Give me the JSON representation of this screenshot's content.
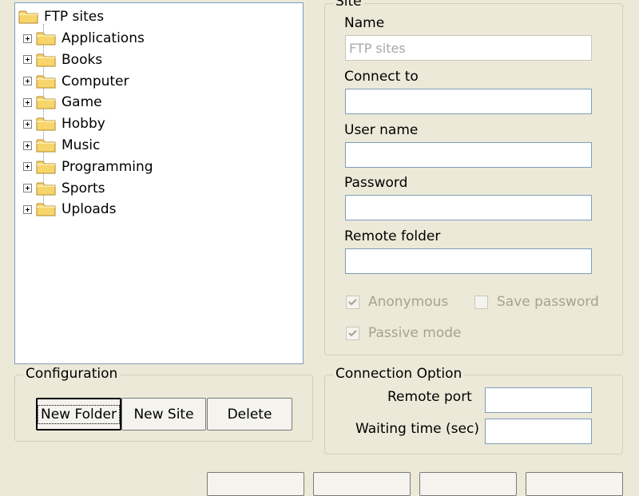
{
  "tree": {
    "root": "FTP sites",
    "items": [
      "Applications",
      "Books",
      "Computer",
      "Game",
      "Hobby",
      "Music",
      "Programming",
      "Sports",
      "Uploads"
    ]
  },
  "site_group": {
    "title": "Site",
    "name_label": "Name",
    "name_value": "FTP sites",
    "connect_label": "Connect to",
    "connect_value": "",
    "user_label": "User name",
    "user_value": "",
    "password_label": "Password",
    "password_value": "",
    "remote_folder_label": "Remote folder",
    "remote_folder_value": "",
    "anonymous_label": "Anonymous",
    "anonymous_checked": true,
    "save_password_label": "Save password",
    "save_password_checked": false,
    "passive_label": "Passive mode",
    "passive_checked": true
  },
  "configuration": {
    "title": "Configuration",
    "new_folder": "New Folder",
    "new_site": "New Site",
    "delete": "Delete"
  },
  "connection_option": {
    "title": "Connection Option",
    "remote_port_label": "Remote port",
    "remote_port_value": "",
    "waiting_time_label": "Waiting time (sec)",
    "waiting_time_value": ""
  },
  "icons": {
    "folder": "folder-icon",
    "expand": "plus-expander-icon",
    "check": "checkmark-icon"
  },
  "colors": {
    "background": "#ECE9D8",
    "border": "#7F9DB9",
    "folder": "#F7D56B",
    "disabled_text": "#A4A290"
  }
}
